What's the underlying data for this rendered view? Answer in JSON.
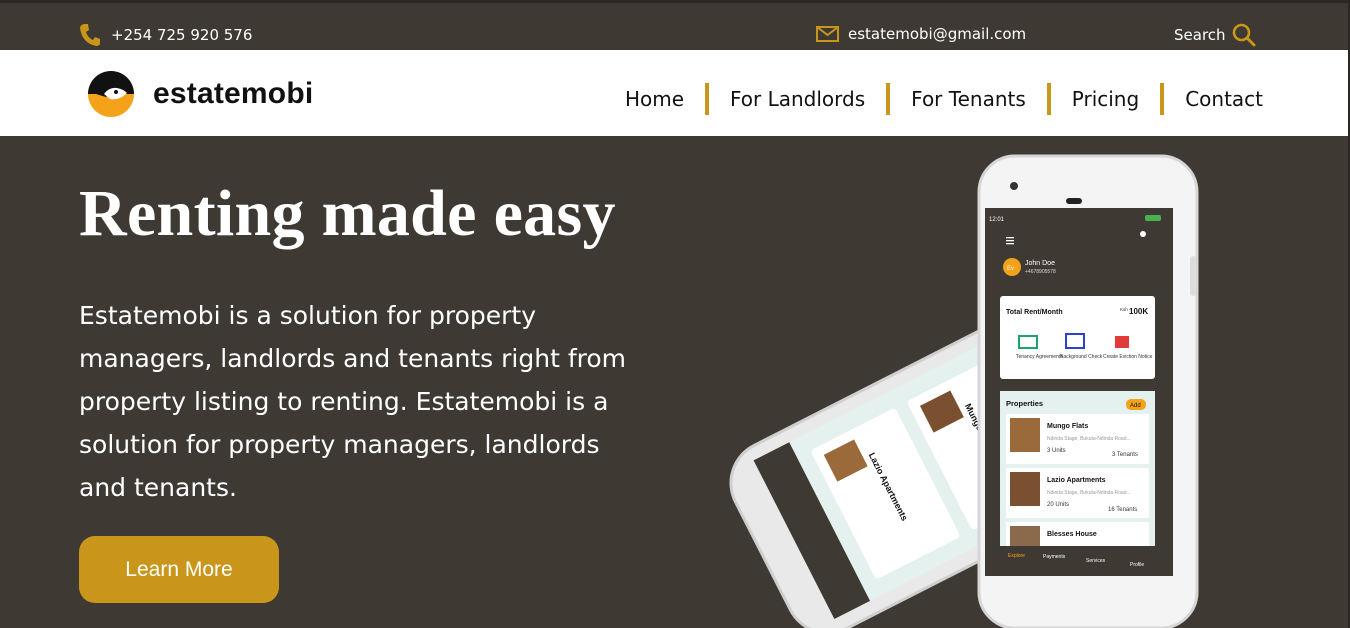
{
  "topbar": {
    "phone": "+254 725 920 576",
    "email": "estatemobi@gmail.com",
    "search_label": "Search"
  },
  "brand": {
    "name": "estatemobi"
  },
  "nav": [
    {
      "label": "Home"
    },
    {
      "label": "For Landlords"
    },
    {
      "label": "For Tenants"
    },
    {
      "label": "Pricing"
    },
    {
      "label": "Contact"
    }
  ],
  "hero": {
    "title": "Renting made easy",
    "description": "Estatemobi is a solution for property managers, landlords and tenants right from property listing to renting. Estatemobi is a solution for property managers, landlords and tenants.",
    "cta": "Learn More"
  },
  "app": {
    "time": "12:01",
    "user_initials": "Ev",
    "user_name": "John Doe",
    "user_phone": "+4678905578",
    "rent_label": "Total Rent/Month",
    "rent_currency": "Ksh",
    "rent_value": "100K",
    "actions": [
      "Tenancy Agreements",
      "Background Check",
      "Create Eviction Notice"
    ],
    "properties_title": "Properties",
    "add_label": "Add",
    "properties": [
      {
        "name": "Mungo Flats",
        "address": "Ndinda Stage, Bukuta-Ndinda Road...",
        "units": "3 Units",
        "tenants": "3 Tenants"
      },
      {
        "name": "Lazio Apartments",
        "address": "Ndinda Stage, Bukuta-Ndinda Road...",
        "units": "20 Units",
        "tenants": "16 Tenants"
      },
      {
        "name": "Blesses House",
        "address": "",
        "units": "",
        "tenants": ""
      }
    ],
    "tabs": [
      "Explore",
      "Payments",
      "Services",
      "Profile"
    ]
  },
  "colors": {
    "accent": "#c9961b",
    "background": "#3e3a33",
    "orange": "#f5a21b"
  }
}
